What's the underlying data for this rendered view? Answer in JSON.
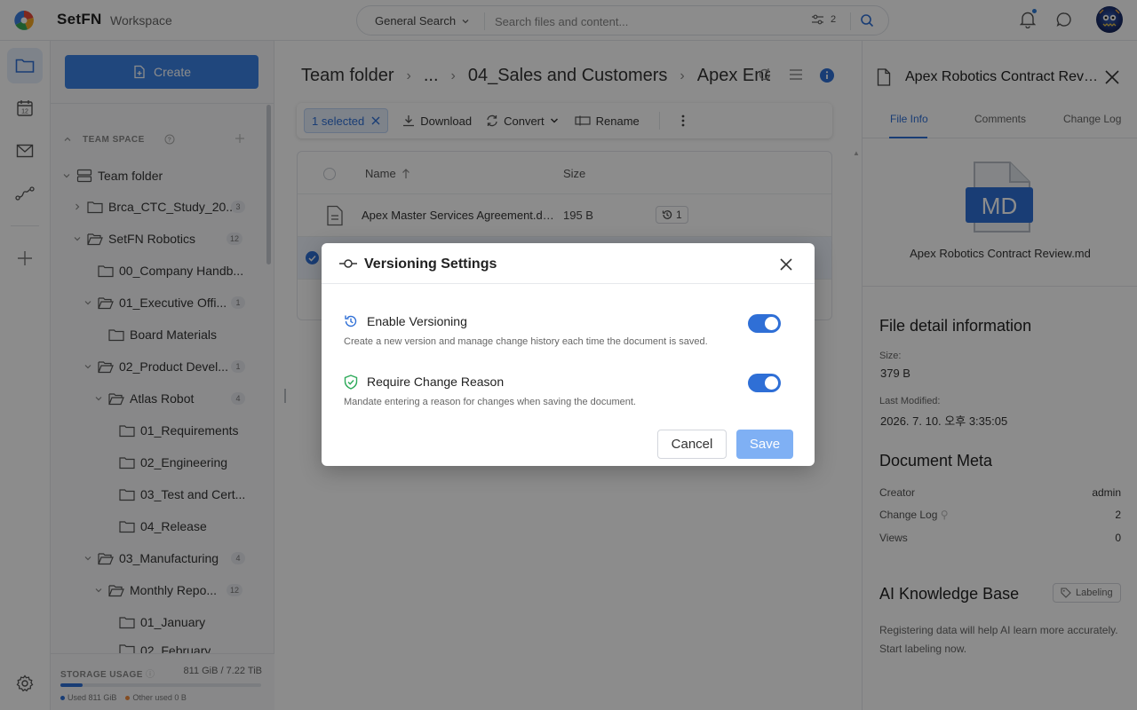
{
  "app": {
    "brand": "SetFN",
    "workspace": "Workspace"
  },
  "search": {
    "scope": "General Search",
    "placeholder": "Search files and content...",
    "filter_count": "2"
  },
  "sidebar": {
    "create_label": "Create",
    "team_space_label": "TEAM SPACE",
    "tree": [
      {
        "label": "Team folder",
        "count": ""
      },
      {
        "label": "Brca_CTC_Study_20...",
        "count": "3"
      },
      {
        "label": "SetFN Robotics",
        "count": "12"
      },
      {
        "label": "00_Company Handb...",
        "count": ""
      },
      {
        "label": "01_Executive Offi...",
        "count": "1"
      },
      {
        "label": "Board Materials",
        "count": ""
      },
      {
        "label": "02_Product Devel...",
        "count": "1"
      },
      {
        "label": "Atlas Robot",
        "count": "4"
      },
      {
        "label": "01_Requirements",
        "count": ""
      },
      {
        "label": "02_Engineering",
        "count": ""
      },
      {
        "label": "03_Test and Cert...",
        "count": ""
      },
      {
        "label": "04_Release",
        "count": ""
      },
      {
        "label": "03_Manufacturing",
        "count": "4"
      },
      {
        "label": "Monthly Repo...",
        "count": "12"
      },
      {
        "label": "01_January",
        "count": ""
      },
      {
        "label": "02_February",
        "count": ""
      }
    ],
    "storage": {
      "title": "STORAGE USAGE",
      "amount": "811 GiB / 7.22 TiB",
      "used_fraction": 0.11,
      "used_label": "Used 811 GiB",
      "other_label": "Other used 0 B"
    }
  },
  "main": {
    "breadcrumb": [
      "Team folder",
      "...",
      "04_Sales and Customers",
      "Apex Ene"
    ],
    "toolbar": {
      "selected": "1 selected",
      "download": "Download",
      "convert": "Convert",
      "rename": "Rename"
    },
    "table": {
      "col_name": "Name",
      "col_size": "Size",
      "rows": [
        {
          "name": "Apex Master Services Agreement.do...",
          "size": "195 B",
          "versions": "1"
        }
      ]
    }
  },
  "right_panel": {
    "title": "Apex Robotics Contract Revie...",
    "tabs": [
      "File Info",
      "Comments",
      "Change Log"
    ],
    "file_type": "MD",
    "filename": "Apex Robotics Contract Review.md",
    "detail_title": "File detail information",
    "size_label": "Size:",
    "size_value": "379 B",
    "modified_label": "Last Modified:",
    "modified_value": "2026. 7. 10. 오후 3:35:05",
    "meta_title": "Document Meta",
    "meta": [
      {
        "label": "Creator",
        "value": "admin"
      },
      {
        "label": "Change Log",
        "value": "2"
      },
      {
        "label": "Views",
        "value": "0"
      }
    ],
    "ai_title": "AI Knowledge Base",
    "labeling_label": "Labeling",
    "ai_desc": "Registering data will help AI learn more accurately. Start labeling now."
  },
  "modal": {
    "title": "Versioning Settings",
    "options": [
      {
        "title": "Enable Versioning",
        "desc": "Create a new version and manage change history each time the document is saved.",
        "enabled": true
      },
      {
        "title": "Require Change Reason",
        "desc": "Mandate entering a reason for changes when saving the document.",
        "enabled": true
      }
    ],
    "cancel_label": "Cancel",
    "save_label": "Save"
  },
  "colors": {
    "accent": "#2f6fd6",
    "create_button": "#3b82e4",
    "save_disabled": "#7fb0f4"
  }
}
